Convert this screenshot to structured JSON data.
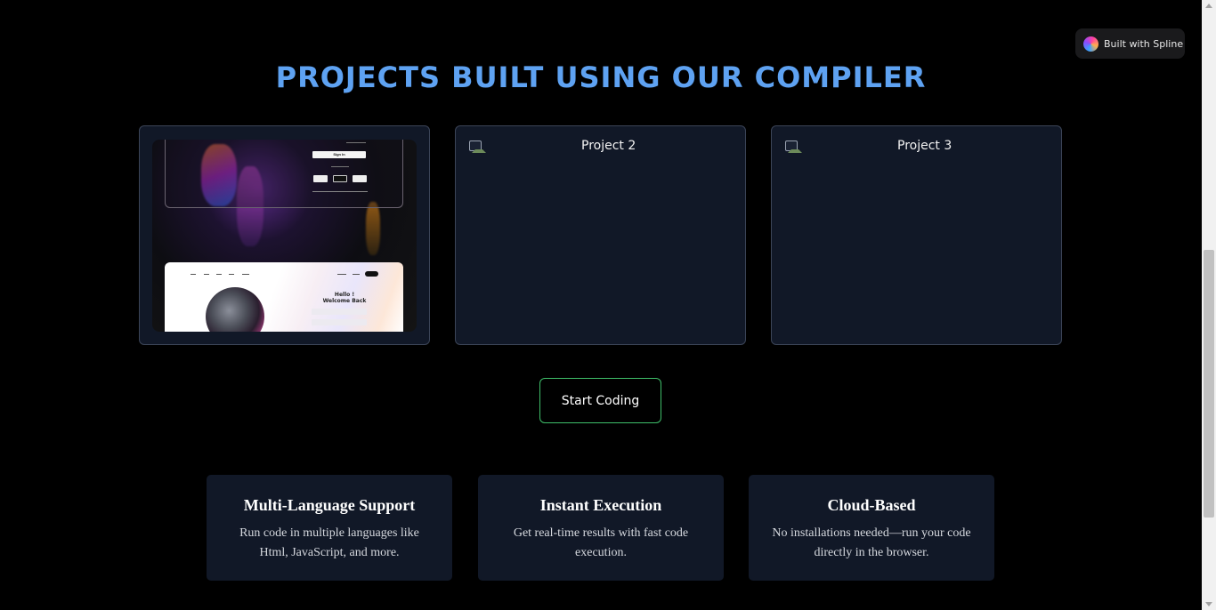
{
  "badge": {
    "label": "Built with Spline",
    "icon": "spline-logo-icon"
  },
  "section": {
    "title": "PROJECTS BUILT USING OUR COMPILER"
  },
  "projects": [
    {
      "alt": "Project 1"
    },
    {
      "alt": "Project 2"
    },
    {
      "alt": "Project 3"
    }
  ],
  "project1_preview": {
    "signin_button": "Sign In",
    "hello_text": "Hello !",
    "welcome_text": "Welcome Back"
  },
  "cta": {
    "label": "Start Coding"
  },
  "features": [
    {
      "title": "Multi-Language Support",
      "description": "Run code in multiple languages like Html, JavaScript, and more."
    },
    {
      "title": "Instant Execution",
      "description": "Get real-time results with fast code execution."
    },
    {
      "title": "Cloud-Based",
      "description": "No installations needed—run your code directly in the browser."
    }
  ],
  "colors": {
    "accent": "#5ea2f2",
    "button_border": "#3fbf6a",
    "card_bg": "#111827",
    "card_border": "#3b4457"
  }
}
